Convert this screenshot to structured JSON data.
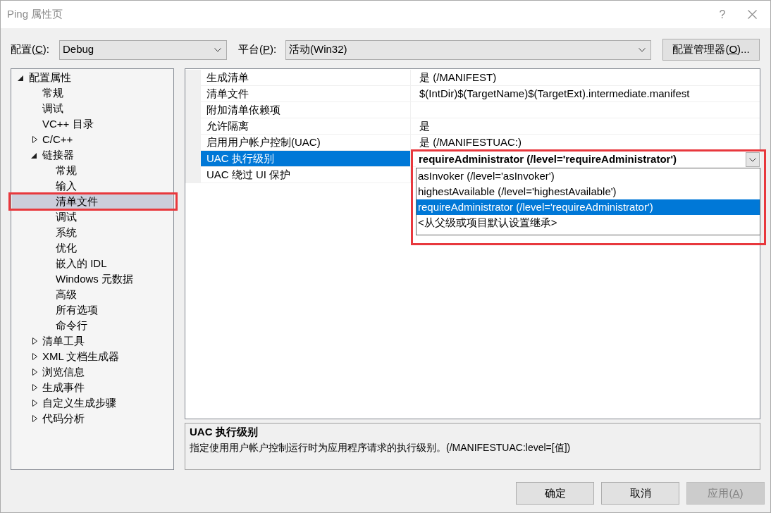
{
  "window": {
    "title": "Ping 属性页",
    "help_button": "?"
  },
  "toolbar": {
    "configuration": {
      "label_before": "配置(",
      "access_key": "C",
      "label_after": "):",
      "value": "Debug"
    },
    "platform": {
      "label_before": "平台(",
      "access_key": "P",
      "label_after": "):",
      "value": "活动(Win32)"
    },
    "manager_button": {
      "label_before": "配置管理器(",
      "access_key": "O",
      "label_after": ")..."
    }
  },
  "tree": [
    {
      "label": "配置属性",
      "expanded": true,
      "selected": false,
      "children": [
        {
          "label": "常规",
          "selected": false
        },
        {
          "label": "调试",
          "selected": false
        },
        {
          "label": "VC++ 目录",
          "selected": false
        },
        {
          "label": "C/C++",
          "expanded": false,
          "selected": false
        },
        {
          "label": "链接器",
          "expanded": true,
          "selected": false,
          "children": [
            {
              "label": "常规",
              "selected": false
            },
            {
              "label": "输入",
              "selected": false
            },
            {
              "label": "清单文件",
              "selected": true
            },
            {
              "label": "调试",
              "selected": false
            },
            {
              "label": "系统",
              "selected": false
            },
            {
              "label": "优化",
              "selected": false
            },
            {
              "label": "嵌入的 IDL",
              "selected": false
            },
            {
              "label": "Windows 元数据",
              "selected": false
            },
            {
              "label": "高级",
              "selected": false
            },
            {
              "label": "所有选项",
              "selected": false
            },
            {
              "label": "命令行",
              "selected": false
            }
          ]
        },
        {
          "label": "清单工具",
          "expanded": false,
          "selected": false
        },
        {
          "label": "XML 文档生成器",
          "expanded": false,
          "selected": false
        },
        {
          "label": "浏览信息",
          "expanded": false,
          "selected": false
        },
        {
          "label": "生成事件",
          "expanded": false,
          "selected": false
        },
        {
          "label": "自定义生成步骤",
          "expanded": false,
          "selected": false
        },
        {
          "label": "代码分析",
          "expanded": false,
          "selected": false
        }
      ]
    }
  ],
  "properties": [
    {
      "name": "生成清单",
      "value": "是 (/MANIFEST)",
      "modified": false,
      "selected": false
    },
    {
      "name": "清单文件",
      "value": "$(IntDir)$(TargetName)$(TargetExt).intermediate.manifest",
      "modified": false,
      "selected": false
    },
    {
      "name": "附加清单依赖项",
      "selected": false
    },
    {
      "name": "允许隔离",
      "value": "是",
      "modified": false,
      "selected": false
    },
    {
      "name": "启用用户帐户控制(UAC)",
      "value": "是 (/MANIFESTUAC:)",
      "modified": false,
      "selected": false
    },
    {
      "name": "UAC 执行级别",
      "value": "requireAdministrator (/level='requireAdministrator')",
      "modified": true,
      "selected": true,
      "dropdown_open": true,
      "options": [
        {
          "label": "asInvoker (/level='asInvoker')",
          "selected": false
        },
        {
          "label": "highestAvailable (/level='highestAvailable')",
          "selected": false
        },
        {
          "label": "requireAdministrator (/level='requireAdministrator')",
          "selected": true
        },
        {
          "label": "<从父级或项目默认设置继承>",
          "selected": false
        }
      ]
    },
    {
      "name": "UAC 绕过 UI 保护",
      "selected": false
    }
  ],
  "description": {
    "title": "UAC 执行级别",
    "text": "指定使用用户帐户控制运行时为应用程序请求的执行级别。(/MANIFESTUAC:level=[值])"
  },
  "buttons": [
    {
      "label": "确定",
      "disabled": false
    },
    {
      "label": "取消",
      "disabled": false
    },
    {
      "label_before": "应用(",
      "access_key": "A",
      "label_after": ")",
      "disabled": true
    }
  ]
}
